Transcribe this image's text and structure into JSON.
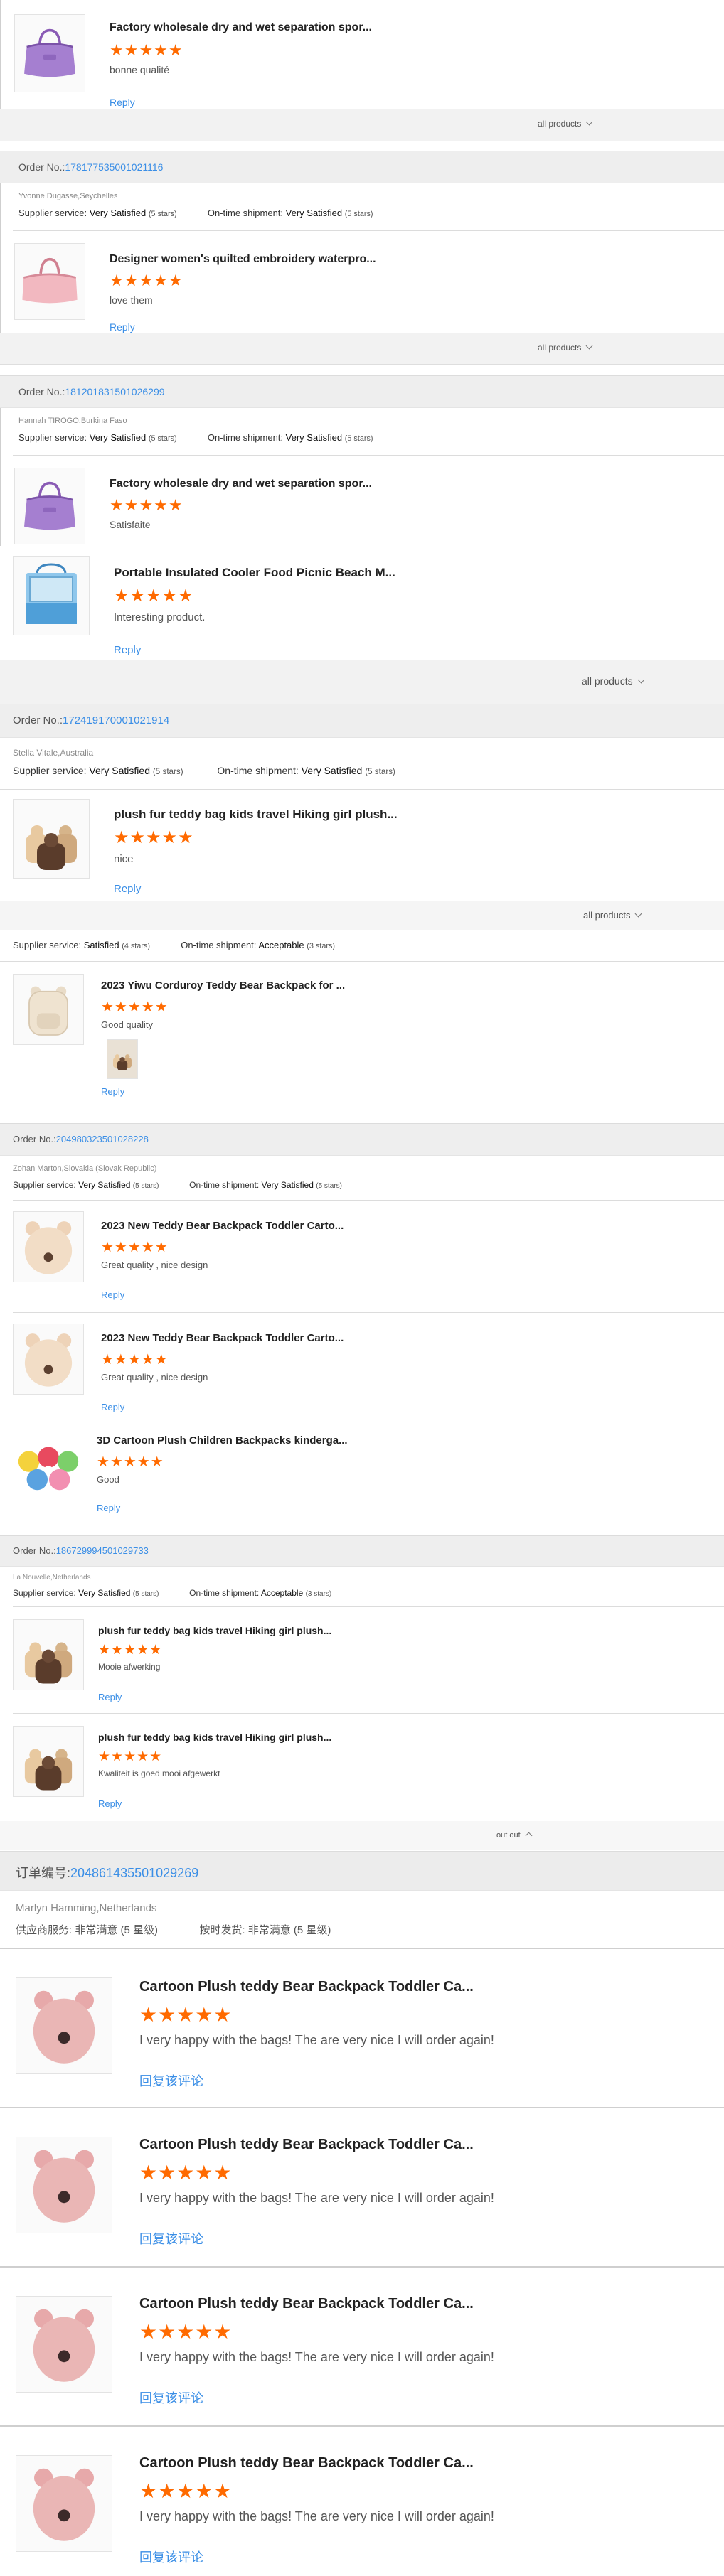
{
  "labels": {
    "order_no": "Order No.: ",
    "supplier_service": "Supplier service:",
    "on_time_shipment": "On-time shipment:",
    "reply": "Reply",
    "all_products": "all products",
    "put_out": "out out",
    "cn_order_no": "订单编号:",
    "cn_supplier_service": "供应商服务:",
    "cn_on_time_shipment": "按时发货:",
    "cn_reply": "回复该评论"
  },
  "orders": [
    {
      "items": [
        {
          "title": "Factory wholesale dry and wet separation spor...",
          "stars": "★★★★★",
          "comment": "bonne qualité",
          "image": "purple-bag"
        }
      ]
    },
    {
      "order_no": "178177535001021116",
      "buyer": "Yvonne Dugasse,Seychelles",
      "supplier_rating": "Very Satisfied",
      "supplier_stars": "(5 stars)",
      "shipment_rating": "Very Satisfied",
      "shipment_stars": "(5 stars)",
      "items": [
        {
          "title": "Designer women's quilted embroidery waterpro...",
          "stars": "★★★★★",
          "comment": "love them",
          "image": "pink-bag"
        }
      ]
    },
    {
      "order_no": "181201831501026299",
      "buyer": "Hannah TIROGO,Burkina Faso",
      "supplier_rating": "Very Satisfied",
      "supplier_stars": "(5 stars)",
      "shipment_rating": "Very Satisfied",
      "shipment_stars": "(5 stars)",
      "items": [
        {
          "title": "Factory wholesale dry and wet separation spor...",
          "stars": "★★★★★",
          "comment": "Satisfaite",
          "image": "purple-bag"
        },
        {
          "title": "Portable Insulated Cooler Food Picnic Beach M...",
          "stars": "★★★★★",
          "comment": "Interesting product.",
          "image": "cooler-bag"
        }
      ]
    },
    {
      "order_no": "172419170001021914",
      "buyer": "Stella Vitale,Australia",
      "supplier_rating": "Very Satisfied",
      "supplier_stars": "(5 stars)",
      "shipment_rating": "Very Satisfied",
      "shipment_stars": "(5 stars)",
      "items": [
        {
          "title": "plush fur teddy bag kids travel Hiking girl plush...",
          "stars": "★★★★★",
          "comment": "nice",
          "image": "teddy-bags"
        }
      ]
    },
    {
      "supplier_rating": "Satisfied",
      "supplier_stars": "(4 stars)",
      "shipment_rating": "Acceptable",
      "shipment_stars": "(3 stars)",
      "items": [
        {
          "title": "2023 Yiwu Corduroy Teddy Bear Backpack for ...",
          "stars": "★★★★★",
          "comment": "Good quality",
          "image": "corduroy-backpack"
        }
      ]
    },
    {
      "order_no": "204980323501028228",
      "buyer": "Zohan Marton,Slovakia (Slovak Republic)",
      "supplier_rating": "Very Satisfied",
      "supplier_stars": "(5 stars)",
      "shipment_rating": "Very Satisfied",
      "shipment_stars": "(5 stars)",
      "items": [
        {
          "title": "2023 New Teddy Bear Backpack Toddler Carto...",
          "stars": "★★★★★",
          "comment": "Great quality , nice design",
          "image": "teddy-backpack"
        },
        {
          "title": "2023 New Teddy Bear Backpack Toddler Carto...",
          "stars": "★★★★★",
          "comment": "Great quality , nice design",
          "image": "teddy-backpack"
        },
        {
          "title": "3D Cartoon Plush Children Backpacks kinderga...",
          "stars": "★★★★★",
          "comment": "Good",
          "image": "cartoon-backpacks"
        }
      ]
    },
    {
      "order_no": "186729994501029733",
      "buyer": "La Nouvelle,Netherlands",
      "supplier_rating": "Very Satisfied",
      "supplier_stars": "(5 stars)",
      "shipment_rating": "Acceptable",
      "shipment_stars": "(3 stars)",
      "items": [
        {
          "title": "plush fur teddy bag kids travel Hiking girl plush...",
          "stars": "★★★★★",
          "comment": "Mooie afwerking",
          "image": "teddy-bags"
        },
        {
          "title": "plush fur teddy bag kids travel Hiking girl plush...",
          "stars": "★★★★★",
          "comment": "Kwaliteit is goed mooi afgewerkt",
          "image": "teddy-bags"
        }
      ]
    },
    {
      "order_no": "204861435501029269",
      "buyer": "Marlyn Hamming,Netherlands",
      "supplier_rating": "非常满意",
      "supplier_stars": "(5 星级)",
      "shipment_rating": "非常满意",
      "shipment_stars": "(5 星级)",
      "items": [
        {
          "title": "Cartoon Plush teddy Bear Backpack Toddler Ca...",
          "stars": "★★★★★",
          "comment": "I very happy with the bags! The are very nice I will order again!",
          "image": "pink-teddy-backpack"
        },
        {
          "title": "Cartoon Plush teddy Bear Backpack Toddler Ca...",
          "stars": "★★★★★",
          "comment": "I very happy with the bags! The are very nice I will order again!",
          "image": "pink-teddy-backpack"
        },
        {
          "title": "Cartoon Plush teddy Bear Backpack Toddler Ca...",
          "stars": "★★★★★",
          "comment": "I very happy with the bags! The are very nice I will order again!",
          "image": "pink-teddy-backpack"
        },
        {
          "title": "Cartoon Plush teddy Bear Backpack Toddler Ca...",
          "stars": "★★★★★",
          "comment": "I very happy with the bags! The are very nice I will order again!",
          "image": "pink-teddy-backpack"
        }
      ]
    }
  ]
}
